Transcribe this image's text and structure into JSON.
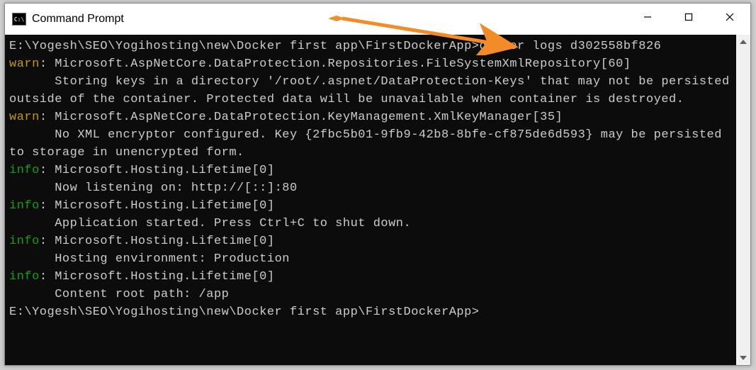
{
  "window": {
    "title": "Command Prompt",
    "icon_text": "C:\\"
  },
  "terminal": {
    "lines": [
      {
        "segments": [
          {
            "cls": "prompt",
            "text": "E:\\Yogesh\\SEO\\Yogihosting\\new\\Docker first app\\FirstDockerApp>"
          },
          {
            "cls": "",
            "text": "docker logs d302558bf826"
          }
        ]
      },
      {
        "segments": [
          {
            "cls": "warn",
            "text": "warn"
          },
          {
            "cls": "",
            "text": ": Microsoft.AspNetCore.DataProtection.Repositories.FileSystemXmlRepository[60]"
          }
        ]
      },
      {
        "segments": [
          {
            "cls": "",
            "text": "      Storing keys in a directory '/root/.aspnet/DataProtection-Keys' that may not be persisted outside of the container. Protected data will be unavailable when container is destroyed."
          }
        ]
      },
      {
        "segments": [
          {
            "cls": "warn",
            "text": "warn"
          },
          {
            "cls": "",
            "text": ": Microsoft.AspNetCore.DataProtection.KeyManagement.XmlKeyManager[35]"
          }
        ]
      },
      {
        "segments": [
          {
            "cls": "",
            "text": "      No XML encryptor configured. Key {2fbc5b01-9fb9-42b8-8bfe-cf875de6d593} may be persisted to storage in unencrypted form."
          }
        ]
      },
      {
        "segments": [
          {
            "cls": "info",
            "text": "info"
          },
          {
            "cls": "",
            "text": ": Microsoft.Hosting.Lifetime[0]"
          }
        ]
      },
      {
        "segments": [
          {
            "cls": "",
            "text": "      Now listening on: http://[::]:80"
          }
        ]
      },
      {
        "segments": [
          {
            "cls": "info",
            "text": "info"
          },
          {
            "cls": "",
            "text": ": Microsoft.Hosting.Lifetime[0]"
          }
        ]
      },
      {
        "segments": [
          {
            "cls": "",
            "text": "      Application started. Press Ctrl+C to shut down."
          }
        ]
      },
      {
        "segments": [
          {
            "cls": "info",
            "text": "info"
          },
          {
            "cls": "",
            "text": ": Microsoft.Hosting.Lifetime[0]"
          }
        ]
      },
      {
        "segments": [
          {
            "cls": "",
            "text": "      Hosting environment: Production"
          }
        ]
      },
      {
        "segments": [
          {
            "cls": "info",
            "text": "info"
          },
          {
            "cls": "",
            "text": ": Microsoft.Hosting.Lifetime[0]"
          }
        ]
      },
      {
        "segments": [
          {
            "cls": "",
            "text": "      Content root path: /app"
          }
        ]
      },
      {
        "segments": [
          {
            "cls": "",
            "text": ""
          }
        ]
      },
      {
        "segments": [
          {
            "cls": "prompt",
            "text": "E:\\Yogesh\\SEO\\Yogihosting\\new\\Docker first app\\FirstDockerApp>"
          }
        ]
      }
    ]
  },
  "colors": {
    "warn": "#c19c00",
    "info": "#13a10e",
    "bg": "#0c0c0c",
    "fg": "#cccccc",
    "arrow": "#f28c28"
  }
}
